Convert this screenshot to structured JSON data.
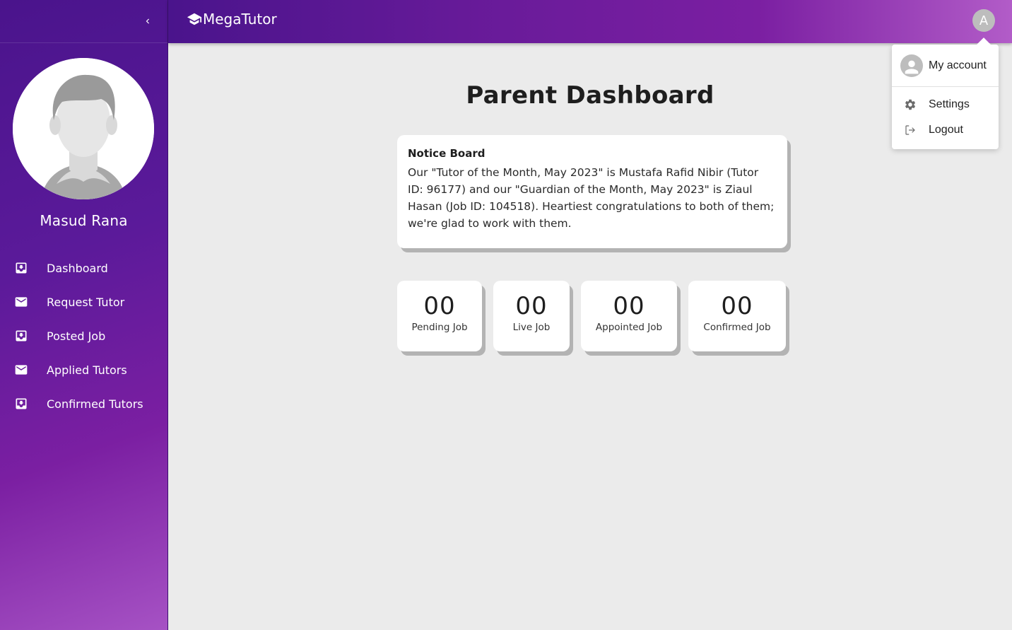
{
  "app": {
    "brand": "MegaTutor"
  },
  "sidebar": {
    "user_name": "Masud Rana",
    "items": [
      {
        "label": "Dashboard",
        "icon": "inbox-download-icon"
      },
      {
        "label": "Request Tutor",
        "icon": "mail-icon"
      },
      {
        "label": "Posted Job",
        "icon": "inbox-download-icon"
      },
      {
        "label": "Applied Tutors",
        "icon": "mail-icon"
      },
      {
        "label": "Confirmed Tutors",
        "icon": "inbox-download-icon"
      }
    ]
  },
  "header": {
    "account_initial": "A"
  },
  "account_menu": {
    "items": [
      {
        "label": "My account",
        "icon": "person-icon"
      },
      {
        "label": "Settings",
        "icon": "gear-icon"
      },
      {
        "label": "Logout",
        "icon": "logout-icon"
      }
    ]
  },
  "main": {
    "title": "Parent Dashboard",
    "notice": {
      "title": "Notice Board",
      "body": "Our \"Tutor of the Month, May 2023\" is Mustafa Rafid Nibir (Tutor ID: 96177) and our \"Guardian of the Month, May 2023\" is Ziaul Hasan (Job ID: 104518). Heartiest congratulations to both of them; we're glad to work with them."
    },
    "stats": [
      {
        "value": "00",
        "label": "Pending Job"
      },
      {
        "value": "00",
        "label": "Live Job"
      },
      {
        "value": "00",
        "label": "Appointed Job"
      },
      {
        "value": "00",
        "label": "Confirmed Job"
      }
    ]
  },
  "colors": {
    "primary": "#4a148c",
    "accent": "#7b1fa2",
    "background": "#ebebeb"
  }
}
